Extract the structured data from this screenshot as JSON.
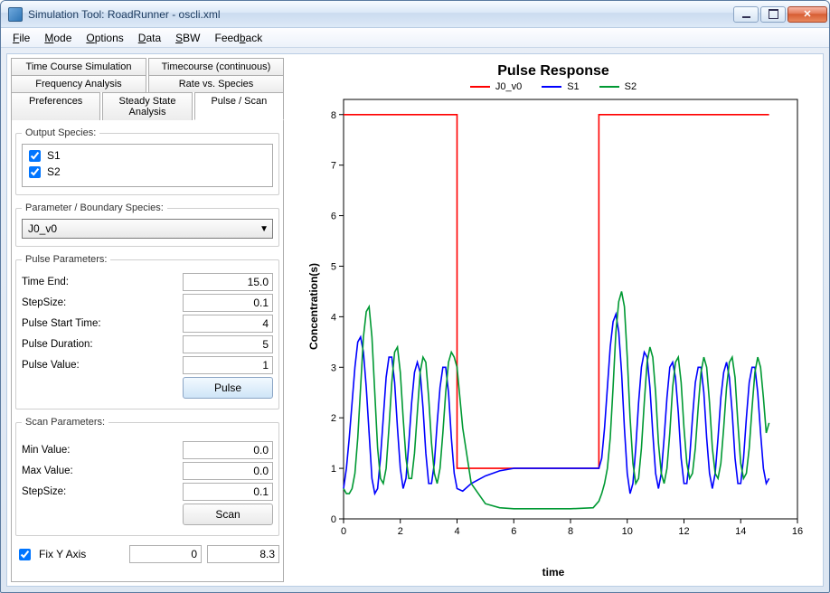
{
  "window": {
    "title": "Simulation Tool: RoadRunner - oscli.xml"
  },
  "menu": {
    "items": [
      "File",
      "Mode",
      "Options",
      "Data",
      "SBW",
      "Feedback"
    ]
  },
  "tabs": {
    "row1": [
      "Time Course Simulation",
      "Timecourse (continuous)"
    ],
    "row2": [
      "Frequency Analysis",
      "Rate vs. Species"
    ],
    "row3": [
      "Preferences",
      "Steady State Analysis",
      "Pulse / Scan"
    ],
    "active": "Pulse / Scan"
  },
  "output_species": {
    "legend": "Output Species:",
    "items": [
      {
        "label": "S1",
        "checked": true
      },
      {
        "label": "S2",
        "checked": true
      }
    ]
  },
  "param_boundary": {
    "legend": "Parameter / Boundary Species:",
    "selected": "J0_v0"
  },
  "pulse_params": {
    "legend": "Pulse Parameters:",
    "time_end_label": "Time End:",
    "time_end": "15.0",
    "stepsize_label": "StepSize:",
    "stepsize": "0.1",
    "start_label": "Pulse Start Time:",
    "start": "4",
    "duration_label": "Pulse Duration:",
    "duration": "5",
    "value_label": "Pulse Value:",
    "value": "1",
    "button": "Pulse"
  },
  "scan_params": {
    "legend": "Scan Parameters:",
    "min_label": "Min Value:",
    "min": "0.0",
    "max_label": "Max Value:",
    "max": "0.0",
    "step_label": "StepSize:",
    "step": "0.1",
    "button": "Scan"
  },
  "fix_y": {
    "label": "Fix Y Axis",
    "checked": true,
    "min": "0",
    "max": "8.3"
  },
  "chart": {
    "title": "Pulse Response",
    "xlabel": "time",
    "ylabel": "Concentration(s)",
    "legend": [
      {
        "name": "J0_v0",
        "color": "#ff0000"
      },
      {
        "name": "S1",
        "color": "#0000ff"
      },
      {
        "name": "S2",
        "color": "#009933"
      }
    ],
    "xticks": [
      0,
      2,
      4,
      6,
      8,
      10,
      12,
      14,
      16
    ],
    "yticks": [
      0,
      1,
      2,
      3,
      4,
      5,
      6,
      7,
      8
    ]
  },
  "chart_data": {
    "type": "line",
    "xlabel": "time",
    "ylabel": "Concentration(s)",
    "title": "Pulse Response",
    "xlim": [
      0,
      16
    ],
    "ylim": [
      0,
      8.3
    ],
    "series": [
      {
        "name": "J0_v0",
        "color": "#ff0000",
        "x": [
          0,
          4,
          4,
          9,
          9,
          15
        ],
        "y": [
          8,
          8,
          1,
          1,
          8,
          8
        ]
      },
      {
        "name": "S1",
        "color": "#0000ff",
        "x": [
          0,
          0.1,
          0.2,
          0.3,
          0.4,
          0.5,
          0.6,
          0.7,
          0.8,
          0.9,
          1.0,
          1.1,
          1.2,
          1.3,
          1.4,
          1.5,
          1.6,
          1.7,
          1.8,
          1.9,
          2.0,
          2.1,
          2.2,
          2.3,
          2.4,
          2.5,
          2.6,
          2.7,
          2.8,
          2.9,
          3.0,
          3.1,
          3.2,
          3.3,
          3.4,
          3.5,
          3.6,
          3.7,
          3.8,
          3.9,
          4.0,
          4.2,
          4.5,
          5.0,
          5.5,
          6.0,
          7.0,
          8.0,
          9.0,
          9.1,
          9.2,
          9.3,
          9.4,
          9.5,
          9.6,
          9.7,
          9.8,
          9.9,
          10.0,
          10.1,
          10.2,
          10.3,
          10.4,
          10.5,
          10.6,
          10.7,
          10.8,
          10.9,
          11.0,
          11.1,
          11.2,
          11.3,
          11.4,
          11.5,
          11.6,
          11.7,
          11.8,
          11.9,
          12.0,
          12.1,
          12.2,
          12.3,
          12.4,
          12.5,
          12.6,
          12.7,
          12.8,
          12.9,
          13.0,
          13.1,
          13.2,
          13.3,
          13.4,
          13.5,
          13.6,
          13.7,
          13.8,
          13.9,
          14.0,
          14.1,
          14.2,
          14.3,
          14.4,
          14.5,
          14.6,
          14.7,
          14.8,
          14.9,
          15.0
        ],
        "y": [
          0.6,
          1.0,
          1.6,
          2.3,
          3.0,
          3.5,
          3.6,
          3.3,
          2.6,
          1.7,
          0.8,
          0.5,
          0.6,
          1.2,
          2.0,
          2.8,
          3.2,
          3.2,
          2.7,
          1.8,
          1.0,
          0.6,
          0.8,
          1.5,
          2.3,
          2.9,
          3.1,
          2.9,
          2.2,
          1.3,
          0.7,
          0.7,
          1.1,
          1.9,
          2.6,
          3.0,
          3.0,
          2.5,
          1.6,
          0.9,
          0.6,
          0.55,
          0.7,
          0.85,
          0.95,
          1.0,
          1.0,
          1.0,
          1.0,
          1.2,
          1.8,
          2.6,
          3.4,
          3.9,
          4.05,
          3.7,
          2.9,
          1.8,
          0.9,
          0.5,
          0.7,
          1.4,
          2.3,
          3.0,
          3.3,
          3.2,
          2.6,
          1.7,
          0.9,
          0.6,
          0.9,
          1.6,
          2.4,
          3.0,
          3.1,
          2.8,
          2.1,
          1.2,
          0.7,
          0.7,
          1.2,
          2.0,
          2.7,
          3.0,
          3.0,
          2.5,
          1.6,
          0.9,
          0.6,
          0.9,
          1.6,
          2.4,
          2.9,
          3.1,
          2.8,
          2.1,
          1.2,
          0.7,
          0.7,
          1.2,
          2.0,
          2.7,
          3.0,
          3.0,
          2.5,
          1.7,
          1.0,
          0.7,
          0.8
        ]
      },
      {
        "name": "S2",
        "color": "#009933",
        "x": [
          0,
          0.1,
          0.2,
          0.3,
          0.4,
          0.5,
          0.6,
          0.7,
          0.8,
          0.9,
          1.0,
          1.1,
          1.2,
          1.3,
          1.4,
          1.5,
          1.6,
          1.7,
          1.8,
          1.9,
          2.0,
          2.1,
          2.2,
          2.3,
          2.4,
          2.5,
          2.6,
          2.7,
          2.8,
          2.9,
          3.0,
          3.1,
          3.2,
          3.3,
          3.4,
          3.5,
          3.6,
          3.7,
          3.8,
          3.9,
          4.0,
          4.2,
          4.5,
          5.0,
          5.5,
          6.0,
          7.0,
          8.0,
          8.8,
          9.0,
          9.1,
          9.2,
          9.3,
          9.4,
          9.5,
          9.6,
          9.7,
          9.8,
          9.9,
          10.0,
          10.1,
          10.2,
          10.3,
          10.4,
          10.5,
          10.6,
          10.7,
          10.8,
          10.9,
          11.0,
          11.1,
          11.2,
          11.3,
          11.4,
          11.5,
          11.6,
          11.7,
          11.8,
          11.9,
          12.0,
          12.1,
          12.2,
          12.3,
          12.4,
          12.5,
          12.6,
          12.7,
          12.8,
          12.9,
          13.0,
          13.1,
          13.2,
          13.3,
          13.4,
          13.5,
          13.6,
          13.7,
          13.8,
          13.9,
          14.0,
          14.1,
          14.2,
          14.3,
          14.4,
          14.5,
          14.6,
          14.7,
          14.8,
          14.9,
          15.0
        ],
        "y": [
          0.6,
          0.5,
          0.5,
          0.6,
          0.9,
          1.6,
          2.6,
          3.6,
          4.1,
          4.2,
          3.6,
          2.5,
          1.4,
          0.8,
          0.7,
          1.0,
          1.8,
          2.7,
          3.3,
          3.4,
          2.9,
          2.0,
          1.2,
          0.8,
          0.8,
          1.3,
          2.1,
          2.9,
          3.2,
          3.1,
          2.4,
          1.5,
          0.9,
          0.7,
          1.0,
          1.7,
          2.5,
          3.1,
          3.3,
          3.2,
          3.0,
          1.8,
          0.7,
          0.3,
          0.22,
          0.2,
          0.2,
          0.2,
          0.22,
          0.35,
          0.5,
          0.7,
          1.0,
          1.6,
          2.6,
          3.7,
          4.3,
          4.5,
          4.2,
          3.2,
          2.0,
          1.1,
          0.7,
          0.8,
          1.4,
          2.3,
          3.1,
          3.4,
          3.2,
          2.5,
          1.5,
          0.9,
          0.7,
          1.0,
          1.7,
          2.6,
          3.1,
          3.2,
          2.7,
          1.8,
          1.1,
          0.8,
          0.9,
          1.4,
          2.2,
          2.9,
          3.2,
          3.0,
          2.3,
          1.4,
          0.9,
          0.8,
          1.1,
          1.8,
          2.6,
          3.1,
          3.2,
          2.8,
          1.9,
          1.1,
          0.8,
          0.9,
          1.4,
          2.2,
          2.9,
          3.2,
          3.0,
          2.4,
          1.7,
          1.9
        ]
      }
    ]
  }
}
